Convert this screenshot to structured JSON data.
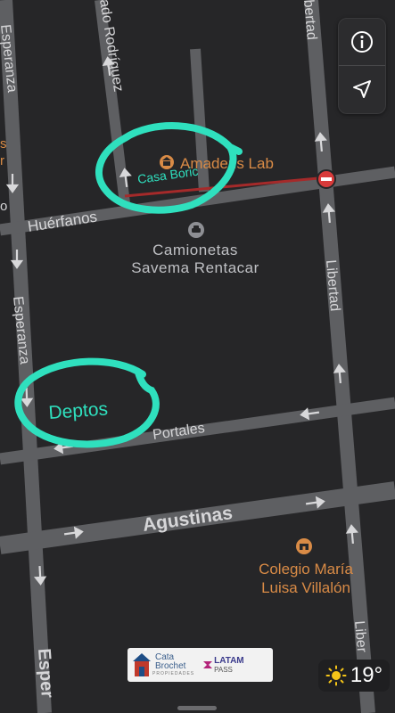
{
  "streets": {
    "esperanza_top": "Esperanza",
    "esperanza_mid": "Esperanza",
    "esperanza_bottom": "Esper",
    "rodriguez": "ado Rodríguez",
    "libertad_top": "bertad",
    "libertad_mid": "Libertad",
    "libertad_bottom": "Liber",
    "huerfanos": "Huérfanos",
    "portales": "Portales",
    "agustinas": "Agustinas"
  },
  "pois": {
    "amadeus": "Amadeus Lab",
    "camionetas_line1": "Camionetas",
    "camionetas_line2": "Savema Rentacar",
    "colegio_line1": "Colegio María",
    "colegio_line2": "Luisa Villalón"
  },
  "annotations": {
    "casa": "Casa Boric",
    "deptos": "Deptos"
  },
  "left_edge": {
    "s_label": "s",
    "r_label": "r",
    "o_label": "o"
  },
  "ad": {
    "brand_line1": "Cata",
    "brand_line2": "Brochet",
    "brand_sub": "PROPIEDADES",
    "latam": "LATAM",
    "pass": "PASS"
  },
  "weather": {
    "temperature": "19°"
  },
  "colors": {
    "road": "#5e5f62",
    "arrow": "#d8d8da",
    "highlight_road": "#a52a2a",
    "annotation": "#2fe0be",
    "poi_orange": "#d98b46",
    "blocked_sign": "#d83a3a",
    "sun": "#f5c518"
  },
  "icons": {
    "info": "info-icon",
    "location": "location-arrow-icon",
    "museum": "museum-icon",
    "car": "car-icon",
    "school": "school-icon",
    "no_entry": "no-entry-icon",
    "sun": "sun-icon"
  }
}
